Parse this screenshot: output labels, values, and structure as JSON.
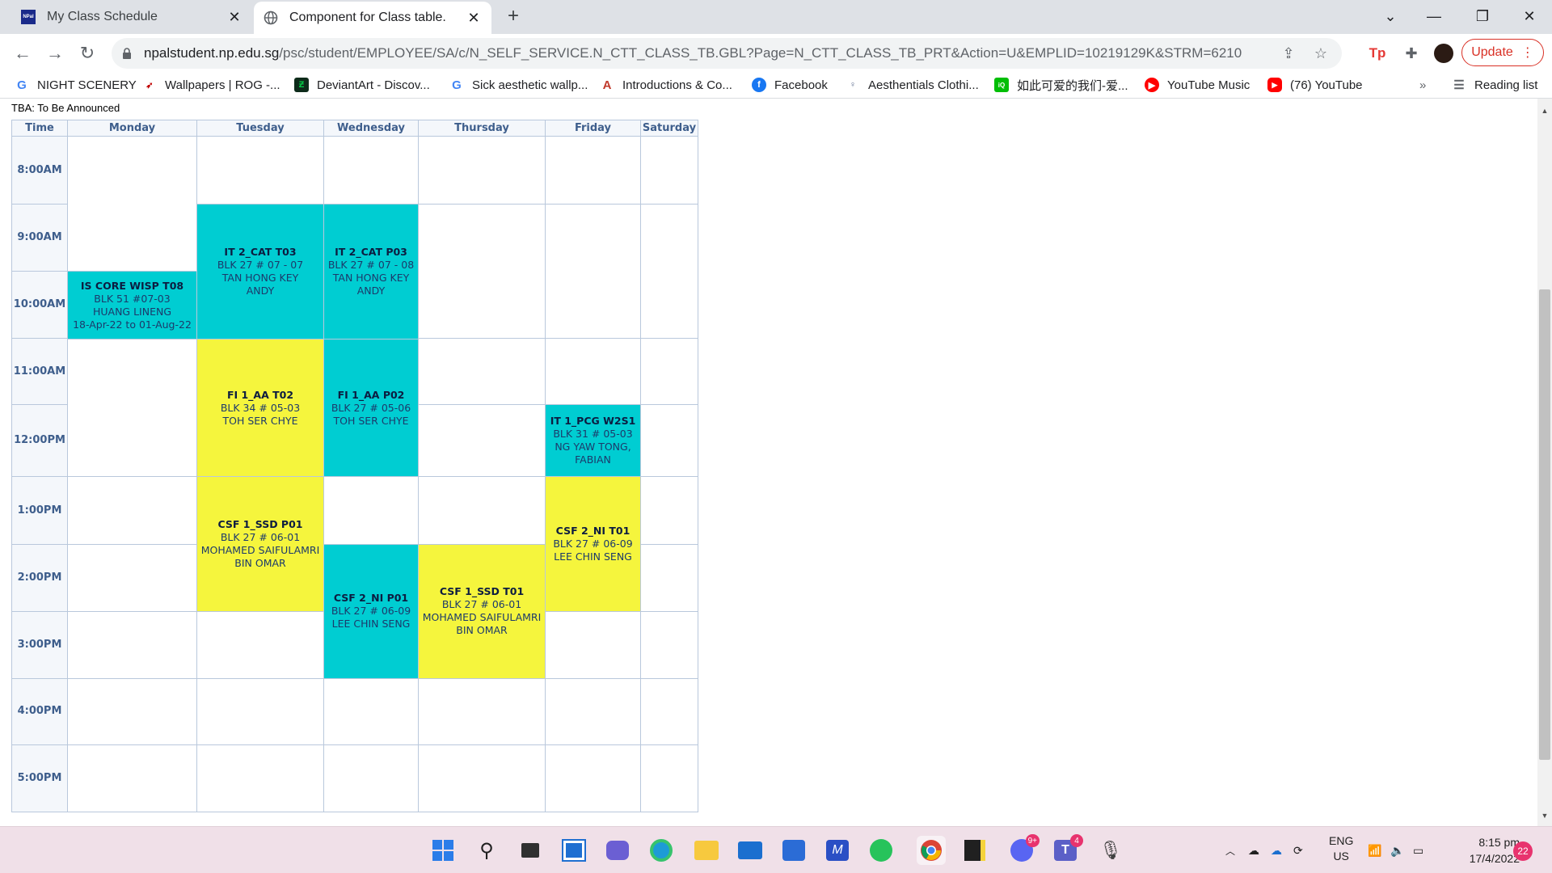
{
  "browser": {
    "tabs": [
      {
        "title": "My Class Schedule",
        "favicon": "np-logo-icon"
      },
      {
        "title": "Component for Class table.",
        "favicon": "globe-icon"
      }
    ],
    "url_host": "npalstudent.np.edu.sg",
    "url_path": "/psc/student/EMPLOYEE/SA/c/N_SELF_SERVICE.N_CTT_CLASS_TB.GBL?Page=N_CTT_CLASS_TB_PRT&Action=U&EMPLID=10219129K&STRM=6210",
    "update_label": "Update",
    "bookmarks": [
      {
        "label": "NIGHT SCENERY",
        "icon": "google-icon",
        "color": "#4285f4"
      },
      {
        "label": "Wallpapers | ROG -...",
        "icon": "rog-icon",
        "color": "#c00000"
      },
      {
        "label": "DeviantArt - Discov...",
        "icon": "deviantart-icon",
        "color": "#05cc47"
      },
      {
        "label": "Sick aesthetic wallp...",
        "icon": "google-icon",
        "color": "#4285f4"
      },
      {
        "label": "Introductions & Co...",
        "icon": "a-logo-icon",
        "color": "#c0392b"
      },
      {
        "label": "Facebook",
        "icon": "facebook-icon",
        "color": "#1877f2"
      },
      {
        "label": "Aesthentials Clothi...",
        "icon": "figure-icon",
        "color": "#607090"
      },
      {
        "label": "如此可爱的我们-爱...",
        "icon": "iqiyi-icon",
        "color": "#00be06"
      },
      {
        "label": "YouTube Music",
        "icon": "youtube-music-icon",
        "color": "#ff0000"
      },
      {
        "label": "(76) YouTube",
        "icon": "youtube-icon",
        "color": "#ff0000"
      }
    ],
    "reading_list": "Reading list"
  },
  "schedule": {
    "tba_note": "TBA: To Be Announced",
    "headers": [
      "Time",
      "Monday",
      "Tuesday",
      "Wednesday",
      "Thursday",
      "Friday",
      "Saturday"
    ],
    "times": [
      "8:00AM",
      "9:00AM",
      "10:00AM",
      "11:00AM",
      "12:00PM",
      "1:00PM",
      "2:00PM",
      "3:00PM",
      "4:00PM",
      "5:00PM"
    ],
    "classes": {
      "it2_cat_t03": {
        "name": "IT 2_CAT T03",
        "room": "BLK 27 # 07 - 07",
        "lecturer": "TAN HONG KEY",
        "lecturer2": "ANDY"
      },
      "it2_cat_p03": {
        "name": "IT 2_CAT P03",
        "room": "BLK 27 # 07 - 08",
        "lecturer": "TAN HONG KEY",
        "lecturer2": "ANDY"
      },
      "is_core_wisp": {
        "name": "IS CORE WISP T08",
        "room": "BLK 51 #07-03",
        "lecturer": "HUANG LINENG",
        "dates": "18-Apr-22 to 01-Aug-22"
      },
      "fi1_aa_t02": {
        "name": "FI 1_AA T02",
        "room": "BLK 34 # 05-03",
        "lecturer": "TOH SER CHYE"
      },
      "fi1_aa_p02": {
        "name": "FI 1_AA P02",
        "room": "BLK 27 # 05-06",
        "lecturer": "TOH SER CHYE"
      },
      "it1_pcg_w2s1": {
        "name": "IT 1_PCG W2S1",
        "room": "BLK 31 # 05-03",
        "lecturer": "NG YAW TONG,",
        "lecturer2": "FABIAN"
      },
      "csf1_ssd_p01": {
        "name": "CSF 1_SSD P01",
        "room": "BLK 27 # 06-01",
        "lecturer": "MOHAMED SAIFULAMRI",
        "lecturer2": "BIN OMAR"
      },
      "csf2_ni_t01": {
        "name": "CSF 2_NI T01",
        "room": "BLK 27 # 06-09",
        "lecturer": "LEE CHIN SENG"
      },
      "csf2_ni_p01": {
        "name": "CSF 2_NI P01",
        "room": "BLK 27 # 06-09",
        "lecturer": "LEE CHIN SENG"
      },
      "csf1_ssd_t01": {
        "name": "CSF 1_SSD T01",
        "room": "BLK 27 # 06-01",
        "lecturer": "MOHAMED SAIFULAMRI",
        "lecturer2": "BIN OMAR"
      }
    },
    "colors": {
      "cyan": "#00cdd2",
      "yellow": "#f5f53d",
      "header": "#3e5e8c"
    }
  },
  "taskbar": {
    "apps": [
      "windows-start-icon",
      "search-icon",
      "task-view-icon",
      "widgets-icon",
      "teams-chat-icon",
      "edge-icon",
      "file-explorer-icon",
      "mail-icon",
      "store-icon",
      "app-icon",
      "whatsapp-icon",
      "chrome-icon",
      "sticky-notes-icon",
      "discord-icon",
      "teams-icon",
      "microphone-icon"
    ],
    "discord_badge": "9+",
    "teams_badge": "4",
    "language": "ENG",
    "region": "US",
    "time": "8:15 pm",
    "date": "17/4/2022",
    "notifications": "22"
  }
}
